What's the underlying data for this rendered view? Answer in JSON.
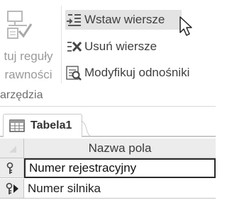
{
  "ribbon": {
    "rules_button": {
      "label_line1": "tuj reguły",
      "label_line2": "rawności",
      "icon": "test-validation-rules-icon"
    },
    "group_label": "arzędzia",
    "insert_rows": {
      "label": "Wstaw wiersze",
      "icon": "insert-rows-icon"
    },
    "delete_rows": {
      "label": "Usuń wiersze",
      "icon": "delete-rows-icon"
    },
    "modify_lookups": {
      "label": "Modyfikuj odnośniki",
      "icon": "modify-lookups-icon"
    }
  },
  "document": {
    "tab": {
      "label": "Tabela1",
      "icon": "table-icon"
    },
    "grid": {
      "header": "Nazwa pola",
      "rows": [
        {
          "field_name": "Numer rejestracyjny",
          "selector_icon": "primary-key-icon"
        },
        {
          "field_name": "Numer silnika",
          "selector_icon": "current-row-key-icon"
        }
      ]
    }
  },
  "colors": {
    "ribbon_hover": "#e3e3e3",
    "grid_header": "#ececec",
    "active_border": "#2b2b2b",
    "disabled_text": "#9a9a9a"
  }
}
